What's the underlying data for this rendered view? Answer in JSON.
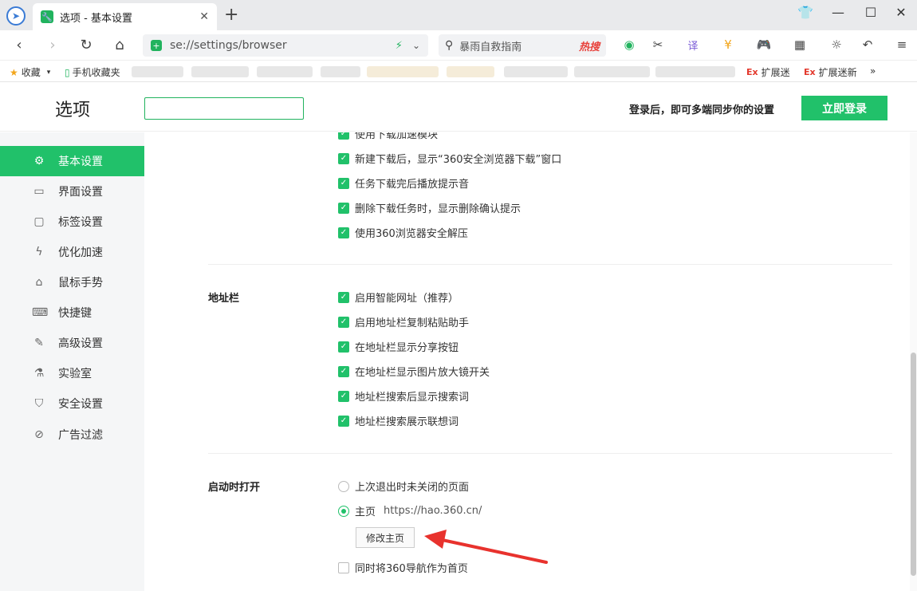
{
  "tab": {
    "title": "选项 - 基本设置"
  },
  "navbar": {
    "url": "se://settings/browser",
    "search_text": "暴雨自救指南",
    "hot_label": "热搜",
    "translate_label": "译"
  },
  "bookmarks": {
    "favorites": "收藏",
    "mobile": "手机收藏夹",
    "ext1": "扩展迷",
    "ext2": "扩展迷新",
    "ex_badge": "Ex",
    "more": "»"
  },
  "header": {
    "title": "选项",
    "search_value": "",
    "login_prompt": "登录后，即可多端同步你的设置",
    "login_button": "立即登录"
  },
  "sidebar": {
    "items": [
      {
        "label": "基本设置",
        "icon": "settings-icon",
        "active": true
      },
      {
        "label": "界面设置",
        "icon": "window-icon"
      },
      {
        "label": "标签设置",
        "icon": "tab-icon"
      },
      {
        "label": "优化加速",
        "icon": "bolt-icon"
      },
      {
        "label": "鼠标手势",
        "icon": "mouse-icon"
      },
      {
        "label": "快捷键",
        "icon": "keyboard-icon"
      },
      {
        "label": "高级设置",
        "icon": "wrench-icon"
      },
      {
        "label": "实验室",
        "icon": "flask-icon"
      },
      {
        "label": "安全设置",
        "icon": "shield-icon"
      },
      {
        "label": "广告过滤",
        "icon": "block-icon"
      }
    ]
  },
  "download": {
    "items": [
      "使用下载加速模块",
      "新建下载后，显示“360安全浏览器下载”窗口",
      "任务下载完后播放提示音",
      "删除下载任务时，显示删除确认提示",
      "使用360浏览器安全解压"
    ]
  },
  "addressbar": {
    "label": "地址栏",
    "items": [
      "启用智能网址（推荐）",
      "启用地址栏复制粘贴助手",
      "在地址栏显示分享按钮",
      "在地址栏显示图片放大镜开关",
      "地址栏搜索后显示搜索词",
      "地址栏搜索展示联想词"
    ]
  },
  "startup": {
    "label": "启动时打开",
    "option_last": "上次退出时未关闭的页面",
    "option_home": "主页",
    "home_url": "https://hao.360.cn/",
    "modify_button": "修改主页",
    "nav_as_home": "同时将360导航作为首页"
  },
  "colors": {
    "accent": "#21c16a",
    "arrow": "#e8322d"
  }
}
